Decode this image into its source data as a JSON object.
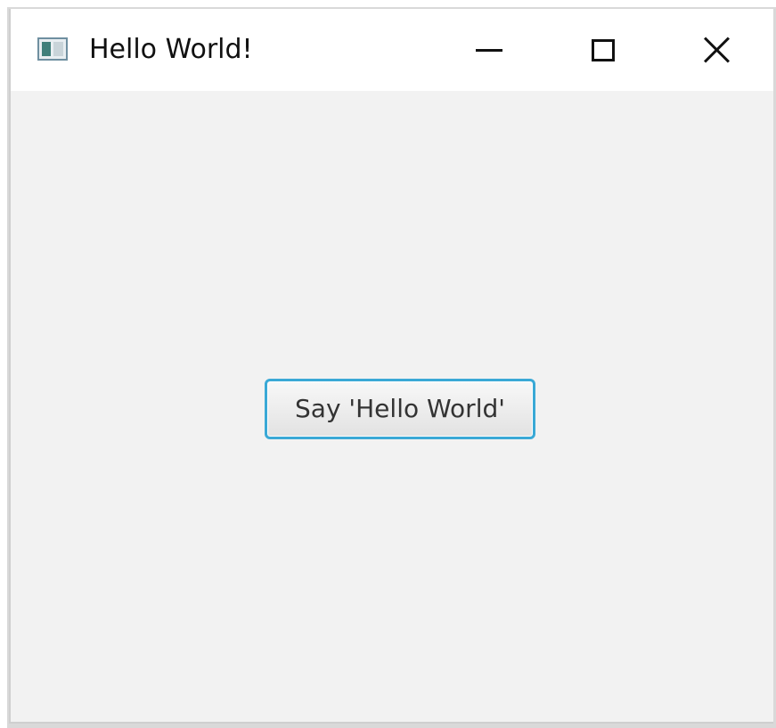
{
  "window": {
    "title": "Hello World!"
  },
  "content": {
    "button_label": "Say 'Hello World'"
  },
  "icons": {
    "app": "application-window-icon",
    "minimize": "minimize-icon",
    "maximize": "maximize-icon",
    "close": "close-icon"
  },
  "colors": {
    "window_background": "#f2f2f2",
    "titlebar_background": "#ffffff",
    "button_focus_border": "#3aa9d6",
    "text": "#111111"
  }
}
